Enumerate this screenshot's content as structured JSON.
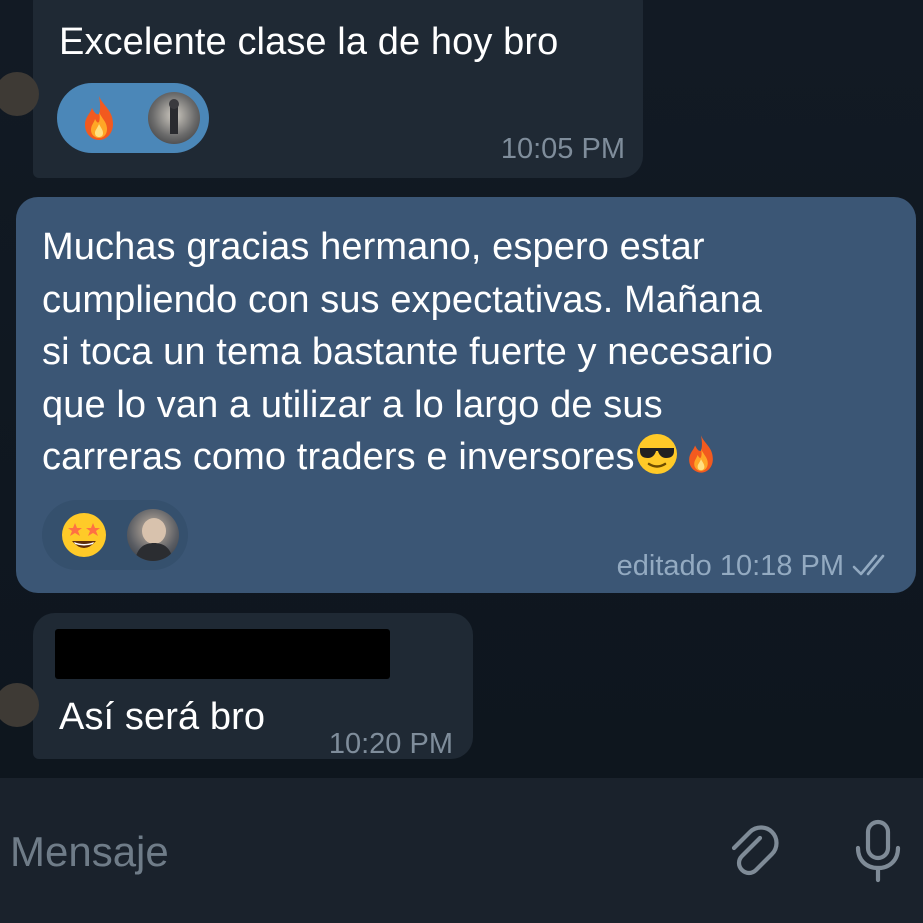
{
  "messages": [
    {
      "direction": "incoming",
      "text": "Excelente clase la de hoy bro",
      "time": "10:05 PM",
      "reactions": [
        {
          "emoji": "fire-emoji"
        },
        {
          "avatar": "user-avatar"
        }
      ]
    },
    {
      "direction": "outgoing",
      "text": "Muchas gracias hermano, espero estar\ncumpliendo con sus expectativas. Mañana\nsi toca un tema bastante fuerte y necesario\nque lo van a utilizar a lo largo de sus\ncarreras como traders e inversores",
      "trailing_emojis": [
        "sunglasses-emoji",
        "fire-emoji"
      ],
      "time": "editado 10:18 PM",
      "status_icon": "double-check-icon",
      "reactions": [
        {
          "emoji": "star-struck-emoji"
        },
        {
          "avatar": "user-avatar"
        }
      ]
    },
    {
      "direction": "incoming",
      "sender_redacted": true,
      "text": "Así será bro",
      "time": "10:20 PM"
    }
  ],
  "composer": {
    "placeholder": "Mensaje",
    "attach_icon": "paperclip-icon",
    "mic_icon": "microphone-icon"
  },
  "colors": {
    "background": "#0f1720",
    "incoming_bubble": "#1f2934",
    "outgoing_bubble": "#3b5675",
    "timestamp": "#7f8d9b",
    "reaction_chip_active": "#4b87b8"
  }
}
